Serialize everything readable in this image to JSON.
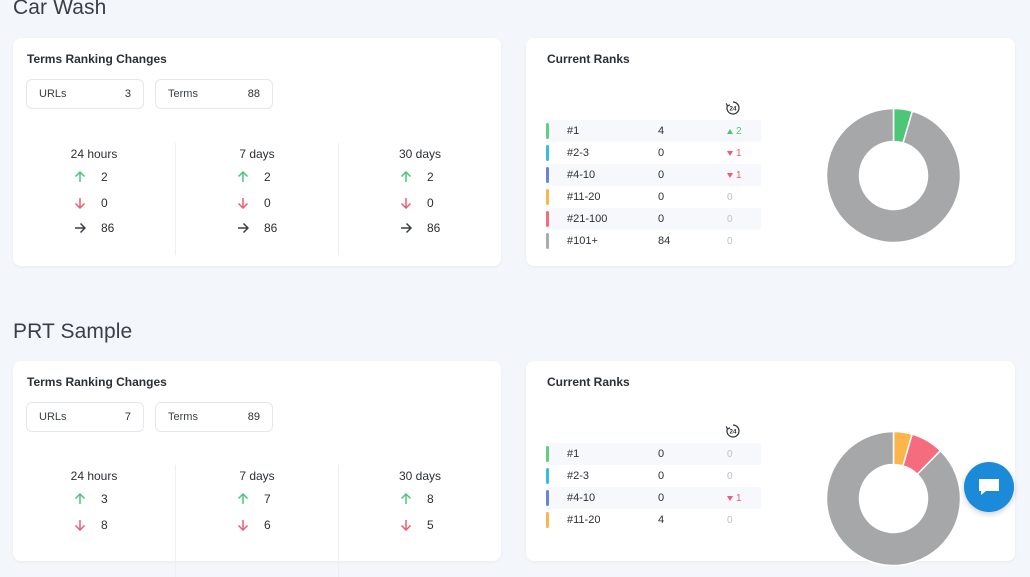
{
  "sections": [
    {
      "title": "Car Wash",
      "changes": {
        "title": "Terms Ranking Changes",
        "urls_label": "URLs",
        "urls_value": "3",
        "terms_label": "Terms",
        "terms_value": "88",
        "periods": [
          {
            "label": "24 hours",
            "up": "2",
            "down": "0",
            "same": "86"
          },
          {
            "label": "7 days",
            "up": "2",
            "down": "0",
            "same": "86"
          },
          {
            "label": "30 days",
            "up": "2",
            "down": "0",
            "same": "86"
          }
        ]
      },
      "ranks": {
        "title": "Current Ranks",
        "rows": [
          {
            "label": "#1",
            "value": "4",
            "change": "2",
            "dir": "up"
          },
          {
            "label": "#2-3",
            "value": "0",
            "change": "1",
            "dir": "down"
          },
          {
            "label": "#4-10",
            "value": "0",
            "change": "1",
            "dir": "down"
          },
          {
            "label": "#11-20",
            "value": "0",
            "change": "0",
            "dir": "flat"
          },
          {
            "label": "#21-100",
            "value": "0",
            "change": "0",
            "dir": "flat"
          },
          {
            "label": "#101+",
            "value": "84",
            "change": "0",
            "dir": "flat"
          }
        ]
      }
    },
    {
      "title": "PRT Sample",
      "changes": {
        "title": "Terms Ranking Changes",
        "urls_label": "URLs",
        "urls_value": "7",
        "terms_label": "Terms",
        "terms_value": "89",
        "periods": [
          {
            "label": "24 hours",
            "up": "3",
            "down": "8",
            "same": ""
          },
          {
            "label": "7 days",
            "up": "7",
            "down": "6",
            "same": ""
          },
          {
            "label": "30 days",
            "up": "8",
            "down": "5",
            "same": ""
          }
        ]
      },
      "ranks": {
        "title": "Current Ranks",
        "rows": [
          {
            "label": "#1",
            "value": "0",
            "change": "0",
            "dir": "flat"
          },
          {
            "label": "#2-3",
            "value": "0",
            "change": "0",
            "dir": "flat"
          },
          {
            "label": "#4-10",
            "value": "0",
            "change": "1",
            "dir": "down"
          },
          {
            "label": "#11-20",
            "value": "4",
            "change": "0",
            "dir": "flat"
          }
        ]
      }
    }
  ],
  "colors": {
    "rank_1": "#5fd07f",
    "rank_2_3": "#38bde0",
    "rank_4_10": "#6b85d6",
    "rank_11_20": "#fbb54b",
    "rank_21_100": "#f46c7d",
    "rank_101": "#a9abae",
    "up": "#4cc777",
    "down": "#f05b70",
    "accent": "#1b8ad8"
  },
  "donut_slices": [
    [
      {
        "name": "#1",
        "count": 4,
        "color": "#4cc777"
      },
      {
        "name": "#101+",
        "count": 84,
        "color": "#a6a7a9"
      }
    ],
    [
      {
        "name": "#11-20",
        "count": 4,
        "color": "#fbb54b"
      },
      {
        "name": "#21-100",
        "count": 7,
        "color": "#f46c7d"
      },
      {
        "name": "#101+",
        "count": 78,
        "color": "#a6a7a9"
      }
    ]
  ],
  "icons": {
    "up": "arrow-up-icon",
    "down": "arrow-down-icon",
    "same": "arrow-right-icon",
    "history": "24h-history-icon",
    "chat": "chat-bubble-icon"
  }
}
